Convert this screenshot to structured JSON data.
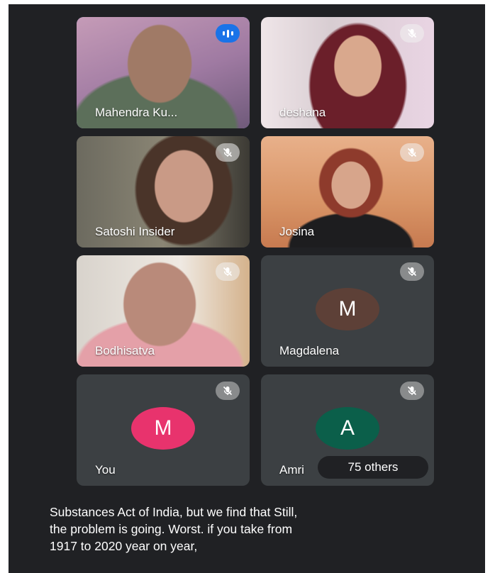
{
  "participants": [
    {
      "name": "Mahendra Ku...",
      "state": "speaking",
      "indicator_icon": "audio-level-icon",
      "accent": "#1a73e8"
    },
    {
      "name": "deshana",
      "state": "muted",
      "indicator_icon": "mic-off-icon"
    },
    {
      "name": "Satoshi Insider",
      "state": "muted",
      "indicator_icon": "mic-off-icon"
    },
    {
      "name": "Josina",
      "state": "muted",
      "indicator_icon": "mic-off-icon"
    },
    {
      "name": "Bodhisatva",
      "state": "muted",
      "indicator_icon": "mic-off-icon"
    },
    {
      "name": "Magdalena",
      "initial": "M",
      "avatar_color": "#5d4037",
      "state": "muted",
      "indicator_icon": "mic-off-icon"
    },
    {
      "name": "You",
      "initial": "M",
      "avatar_color": "#e8336d",
      "state": "muted",
      "indicator_icon": "mic-off-icon"
    },
    {
      "name": "Amri",
      "initial": "A",
      "avatar_color": "#0b5f4a",
      "state": "muted",
      "indicator_icon": "mic-off-icon"
    }
  ],
  "others_count_label": "75 others",
  "caption": {
    "lines": [
      "Substances Act of India, but we find that Still,",
      "the problem is going. Worst. if you take from",
      "1917 to 2020 year on year,"
    ]
  },
  "colors": {
    "background": "#202124",
    "tile": "#3c4043",
    "active_border": "#8ab4f8"
  }
}
